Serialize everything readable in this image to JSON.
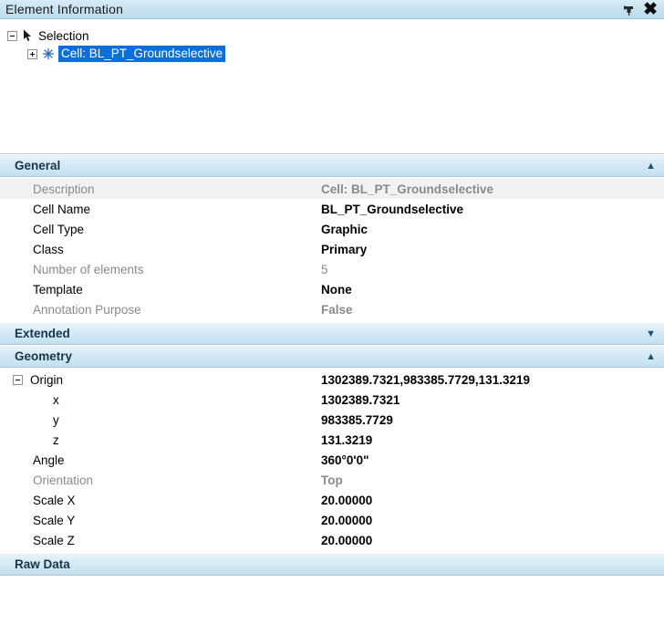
{
  "titlebar": {
    "title": "Element Information",
    "pin_icon": "pin-icon",
    "close_icon": "close-icon",
    "close_label": "✖"
  },
  "tree": {
    "root": {
      "label": "Selection",
      "icon": "arrow-cursor-icon"
    },
    "child": {
      "label": "Cell: BL_PT_Groundselective",
      "icon": "star-icon"
    }
  },
  "sections": {
    "general": {
      "title": "General",
      "chevron": "▲",
      "rows": [
        {
          "name": "Description",
          "value": "Cell: BL_PT_Groundselective",
          "name_grey": true,
          "value_grey": true,
          "value_bold": true,
          "shaded": true
        },
        {
          "name": "Cell Name",
          "value": "BL_PT_Groundselective",
          "name_grey": false,
          "value_grey": false,
          "value_bold": true,
          "shaded": false
        },
        {
          "name": "Cell Type",
          "value": "Graphic",
          "name_grey": false,
          "value_grey": false,
          "value_bold": true,
          "shaded": false
        },
        {
          "name": "Class",
          "value": "Primary",
          "name_grey": false,
          "value_grey": false,
          "value_bold": true,
          "shaded": false
        },
        {
          "name": "Number of elements",
          "value": "5",
          "name_grey": true,
          "value_grey": true,
          "value_bold": false,
          "shaded": false
        },
        {
          "name": "Template",
          "value": "None",
          "name_grey": false,
          "value_grey": false,
          "value_bold": true,
          "shaded": false
        },
        {
          "name": "Annotation Purpose",
          "value": "False",
          "name_grey": true,
          "value_grey": true,
          "value_bold": true,
          "shaded": false
        }
      ]
    },
    "extended": {
      "title": "Extended",
      "chevron": "▼"
    },
    "geometry": {
      "title": "Geometry",
      "chevron": "▲",
      "rows": [
        {
          "name": "Origin",
          "value": "1302389.7321,983385.7729,131.3219",
          "node": true,
          "indent": 0,
          "name_grey": false,
          "value_grey": false,
          "value_bold": true,
          "shaded": false
        },
        {
          "name": "x",
          "value": "1302389.7321",
          "node": false,
          "indent": 1,
          "name_grey": false,
          "value_grey": false,
          "value_bold": true,
          "shaded": false
        },
        {
          "name": "y",
          "value": "983385.7729",
          "node": false,
          "indent": 1,
          "name_grey": false,
          "value_grey": false,
          "value_bold": true,
          "shaded": false
        },
        {
          "name": "z",
          "value": "131.3219",
          "node": false,
          "indent": 1,
          "name_grey": false,
          "value_grey": false,
          "value_bold": true,
          "shaded": false
        },
        {
          "name": "Angle",
          "value": "360°0'0\"",
          "node": false,
          "indent": 0,
          "name_grey": false,
          "value_grey": false,
          "value_bold": true,
          "shaded": false
        },
        {
          "name": "Orientation",
          "value": "Top",
          "node": false,
          "indent": 0,
          "name_grey": true,
          "value_grey": true,
          "value_bold": true,
          "shaded": false
        },
        {
          "name": "Scale X",
          "value": "20.00000",
          "node": false,
          "indent": 0,
          "name_grey": false,
          "value_grey": false,
          "value_bold": true,
          "shaded": false
        },
        {
          "name": "Scale Y",
          "value": "20.00000",
          "node": false,
          "indent": 0,
          "name_grey": false,
          "value_grey": false,
          "value_bold": true,
          "shaded": false
        },
        {
          "name": "Scale Z",
          "value": "20.00000",
          "node": false,
          "indent": 0,
          "name_grey": false,
          "value_grey": false,
          "value_bold": true,
          "shaded": false
        }
      ]
    },
    "raw_data": {
      "title": "Raw Data",
      "chevron": ""
    }
  },
  "colors": {
    "selection_blue": "#0a6fd8",
    "header_blue": "#c3e0f0",
    "grey_text": "#8a8a8a"
  }
}
